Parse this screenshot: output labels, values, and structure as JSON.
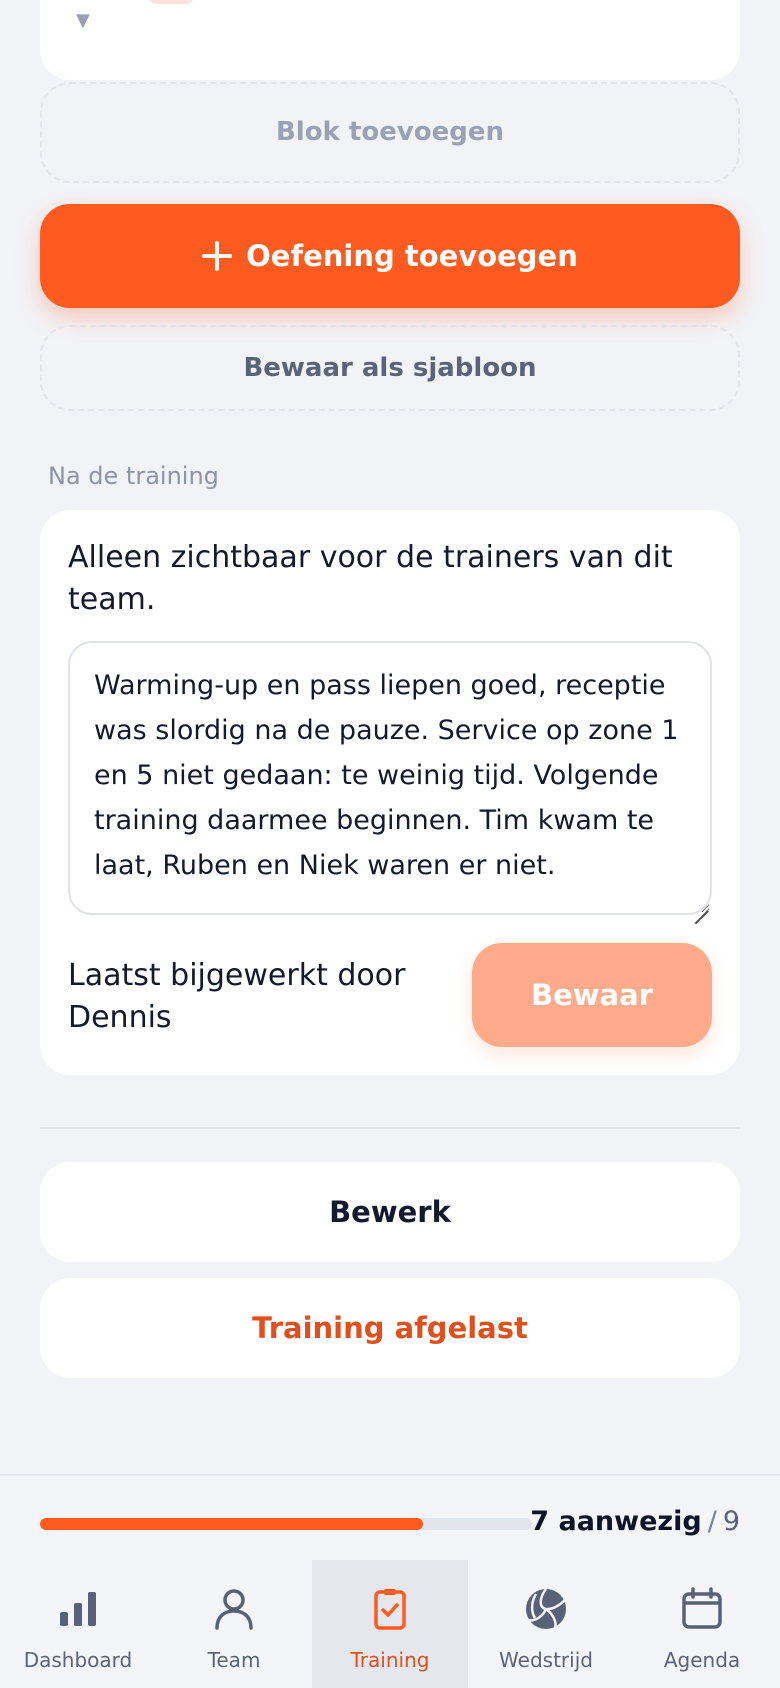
{
  "blocks": {
    "add_block_label": "Blok toevoegen",
    "add_exercise_label": "Oefening toevoegen",
    "save_template_label": "Bewaar als sjabloon"
  },
  "after_training": {
    "section_label": "Na de training",
    "visibility_note": "Alleen zichtbaar voor de trainers van dit team.",
    "notes_value": "Warming-up en pass liepen goed, receptie was slordig na de pauze. Service op zone 1 en 5 niet gedaan: te weinig tijd. Volgende training daarmee beginnen. Tim kwam te laat, Ruben en Niek waren er niet.",
    "updated_by": "Laatst bijgewerkt door Dennis",
    "save_label": "Bewaar"
  },
  "actions": {
    "edit_label": "Bewerk",
    "cancel_training_label": "Training afgelast"
  },
  "attendance": {
    "present_label": "7 aanwezig",
    "separator": "/",
    "total": "9",
    "present": 7,
    "total_count": 9
  },
  "tabs": [
    {
      "label": "Dashboard",
      "icon": "bar-chart-icon",
      "active": false
    },
    {
      "label": "Team",
      "icon": "user-icon",
      "active": false
    },
    {
      "label": "Training",
      "icon": "checklist-icon",
      "active": true
    },
    {
      "label": "Wedstrijd",
      "icon": "volleyball-icon",
      "active": false
    },
    {
      "label": "Agenda",
      "icon": "calendar-icon",
      "active": false
    }
  ],
  "colors": {
    "accent": "#ff5a1f",
    "accent_disabled": "#ffab8b",
    "danger_text": "#e0501c",
    "background": "#f2f3f7"
  }
}
